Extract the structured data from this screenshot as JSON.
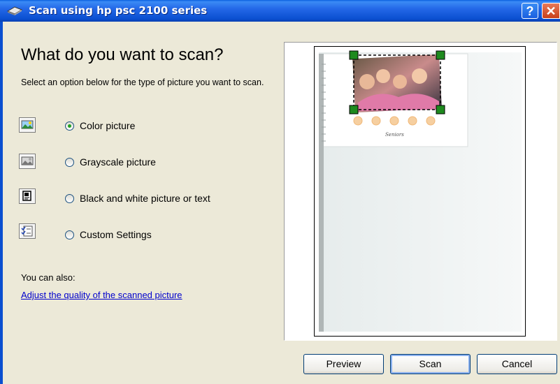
{
  "window": {
    "title": "Scan using hp psc 2100 series",
    "help_glyph": "?",
    "close_glyph": "✕",
    "title_icon": "scanner-icon",
    "title_bar_color": "#0A4FD0"
  },
  "main": {
    "heading": "What do you want to scan?",
    "description": "Select an option below for the type of picture you want to scan.",
    "options": [
      {
        "label": "Color picture",
        "icon": "color-picture-icon",
        "selected": true
      },
      {
        "label": "Grayscale picture",
        "icon": "grayscale-picture-icon",
        "selected": false
      },
      {
        "label": "Black and white picture or text",
        "icon": "bw-picture-icon",
        "selected": false
      },
      {
        "label": "Custom Settings",
        "icon": "custom-settings-icon",
        "selected": false
      }
    ],
    "also_label": "You can also:",
    "quality_link": "Adjust the quality of the scanned picture"
  },
  "preview": {
    "caption": "Seniors"
  },
  "buttons": {
    "preview": "Preview",
    "scan": "Scan",
    "cancel": "Cancel"
  },
  "colors": {
    "dialog_bg": "#ECE9D8",
    "link": "#0000CC",
    "radio_dot": "#21A121",
    "crop_handle": "#1E8A1E"
  }
}
